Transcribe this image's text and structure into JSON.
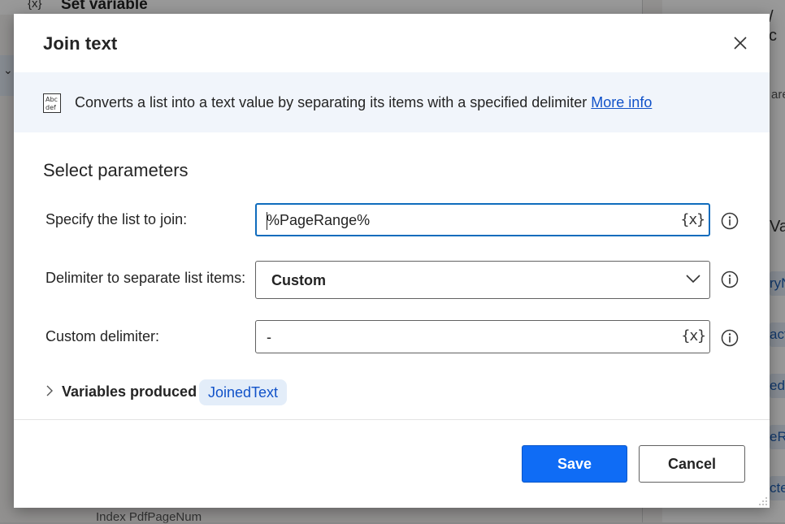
{
  "background": {
    "top_var_icon": "{x}",
    "top_title": "Set variable",
    "right_tab": "/ c",
    "right_text1": "are",
    "right_text2": "Var",
    "right_chips": [
      "ryN",
      "act",
      "ed",
      "eR",
      "cte"
    ],
    "bottom_text": "Index  PdfPageNum"
  },
  "dialog": {
    "title": "Join text",
    "close_icon": "close-icon",
    "banner": {
      "icon": "abc-def-text-icon",
      "description": "Converts a list into a text value by separating its items with a specified delimiter",
      "more_info": "More info"
    },
    "section_title": "Select parameters",
    "list_field": {
      "label": "Specify the list to join:",
      "value": "%PageRange%",
      "var_icon": "{x}"
    },
    "delimiter_field": {
      "label": "Delimiter to separate list items:",
      "value": "Custom"
    },
    "custom_field": {
      "label": "Custom delimiter:",
      "value": "-",
      "var_icon": "{x}"
    },
    "variables": {
      "label": "Variables produced",
      "chip": "JoinedText"
    },
    "buttons": {
      "save": "Save",
      "cancel": "Cancel"
    }
  },
  "colors": {
    "accent": "#0f6cf5",
    "focus_border": "#0f6cbd",
    "link": "#1152c9",
    "banner_bg": "#f1f5fb",
    "chip_bg": "#e3edf9"
  }
}
